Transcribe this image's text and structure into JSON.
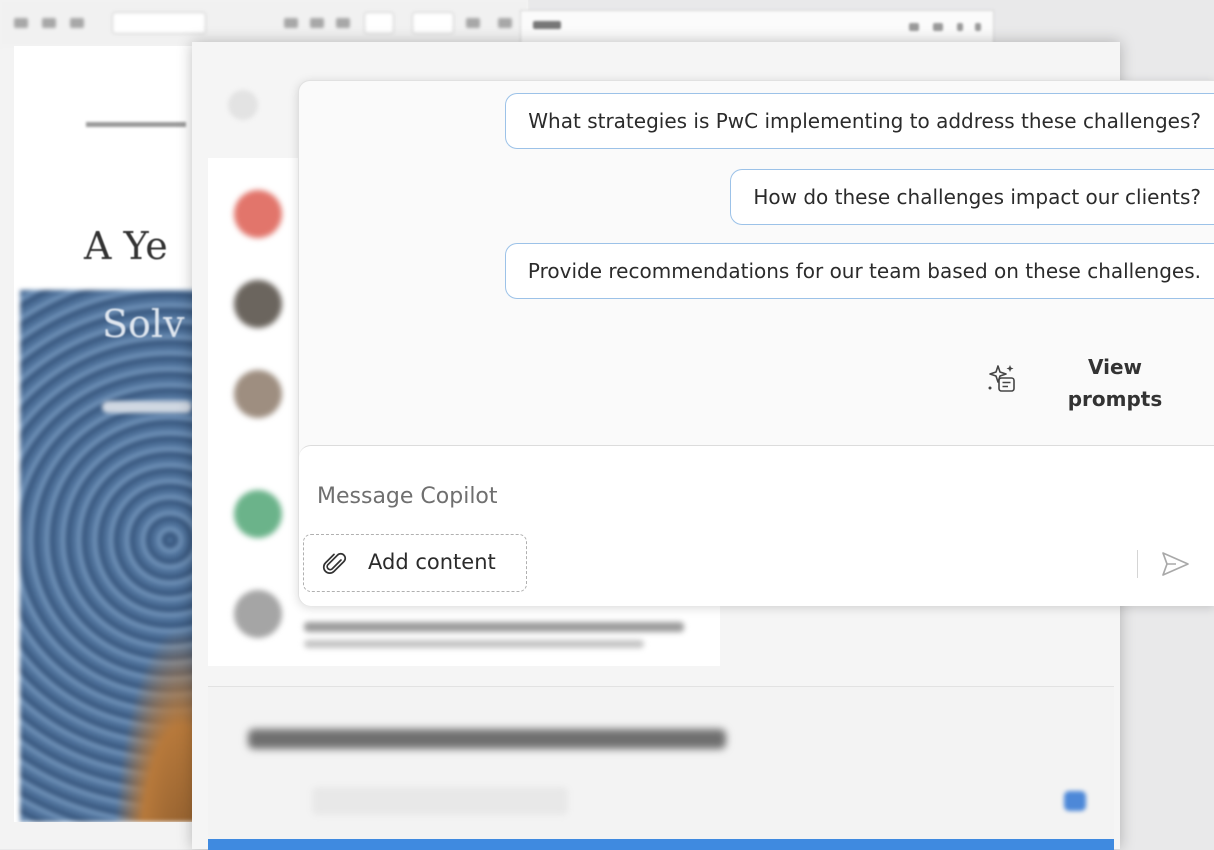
{
  "copilot": {
    "suggestions": [
      "What strategies is PwC implementing to address these challenges?",
      "How do these challenges impact our clients?",
      "Provide recommendations for our team based on these challenges."
    ],
    "view_prompts_line1": "View",
    "view_prompts_line2": "prompts",
    "compose_placeholder": "Message Copilot",
    "add_content_label": "Add content"
  },
  "icons": {
    "view_prompts": "sparkle-prompts-icon",
    "add_content": "paperclip-icon",
    "send": "send-icon"
  },
  "colors": {
    "chip_border": "#9cc2e8",
    "panel_bg": "#fafafa",
    "accent_blue": "#3f8ae0"
  }
}
